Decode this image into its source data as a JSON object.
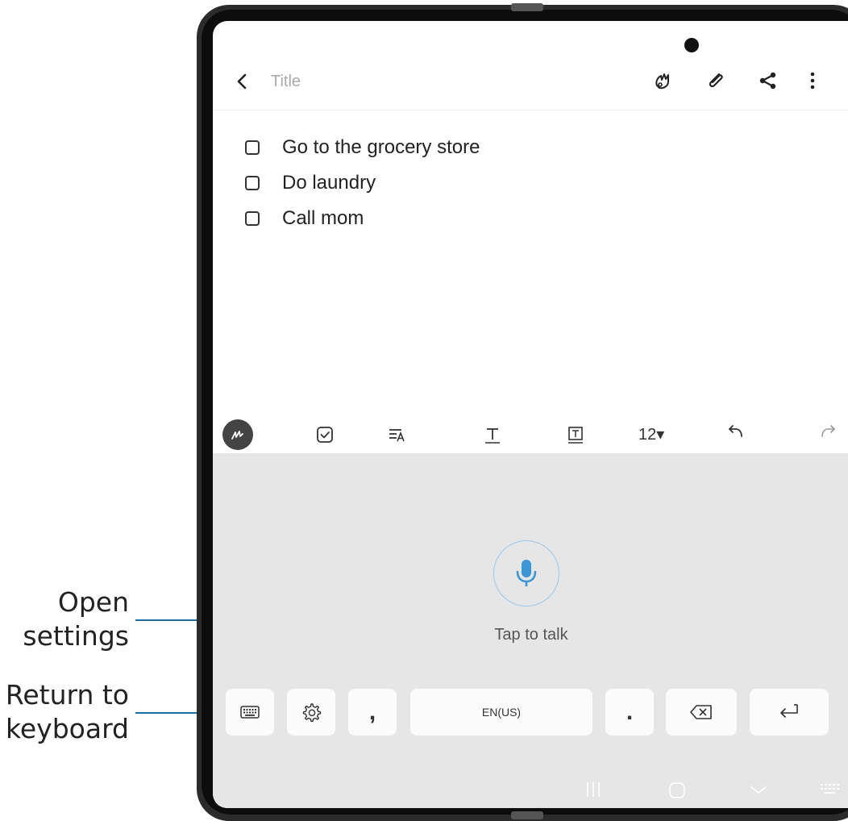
{
  "callouts": {
    "open_settings": [
      "Open",
      "settings"
    ],
    "return_to_keyboard": [
      "Return to",
      "keyboard"
    ]
  },
  "note": {
    "title_placeholder": "Title",
    "checklist": [
      {
        "text": "Go to the grocery store",
        "checked": false
      },
      {
        "text": "Do laundry",
        "checked": false
      },
      {
        "text": "Call mom",
        "checked": false
      }
    ]
  },
  "toolbar_icons": [
    "back-icon",
    "handwriting-icon",
    "attach-icon",
    "share-icon",
    "more-options-icon"
  ],
  "format_toolbar": {
    "icons": [
      "pen-icon",
      "checkbox-icon",
      "text-style-icon",
      "text-color-icon",
      "text-highlight-icon",
      "undo-icon",
      "redo-icon"
    ],
    "font_size": "12▾"
  },
  "voice_input": {
    "tap_to_talk": "Tap to talk",
    "accent_color": "#3b96d6"
  },
  "keyboard_row": {
    "comma": ",",
    "language": "EN(US)",
    "period": ".",
    "icons": [
      "keyboard-icon",
      "settings-icon",
      "backspace-icon",
      "enter-icon"
    ]
  },
  "navigation_bar": {
    "icons": [
      "recents-icon",
      "home-icon",
      "back-nav-icon",
      "keyboard-switch-icon"
    ]
  }
}
